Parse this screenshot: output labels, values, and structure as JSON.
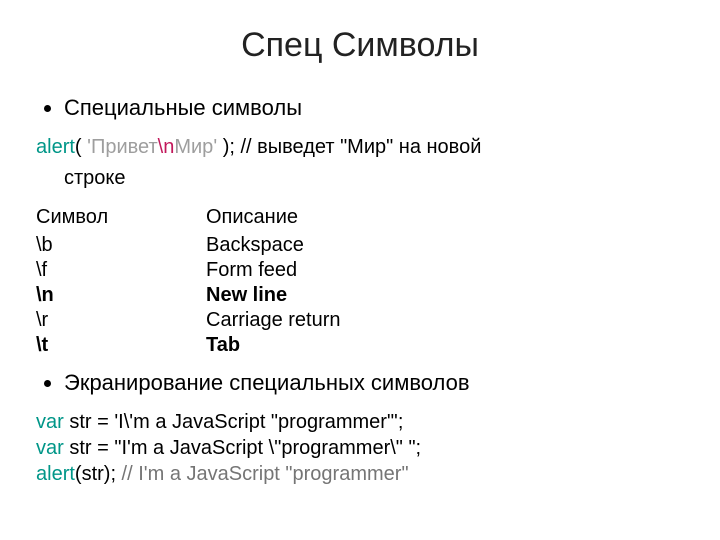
{
  "title": "Спец Символы",
  "bullets": {
    "a": "Специальные символы",
    "b": "Экранирование специальных символов"
  },
  "ex1": {
    "fn": "alert",
    "open": "( ",
    "q1": "'",
    "s1": "Привет",
    "esc": "\\n",
    "s2": "Мир",
    "q2": "'",
    "close": " );",
    "comment": " // выведет \"Мир\" на новой",
    "cont": "строке"
  },
  "table": {
    "h1": "Символ",
    "h2": "Описание",
    "rows": [
      {
        "s": "\\b",
        "d": "Backspace",
        "bold": false
      },
      {
        "s": "\\f",
        "d": "Form feed",
        "bold": false
      },
      {
        "s": "\\n",
        "d": "New line",
        "bold": true
      },
      {
        "s": "\\r",
        "d": "Carriage return",
        "bold": false
      },
      {
        "s": "\\t",
        "d": "Tab",
        "bold": true
      }
    ]
  },
  "ex2": {
    "l1_kw": "var",
    "l1_rest": " str = 'I\\'m a JavaScript \"programmer\"';",
    "l2_kw": "var",
    "l2_rest": " str = \"I'm a JavaScript \\\"programmer\\\" \";",
    "l3_fn": "alert",
    "l3_call": "(str);",
    "l3_comment": " // I'm a JavaScript \"programmer\""
  }
}
